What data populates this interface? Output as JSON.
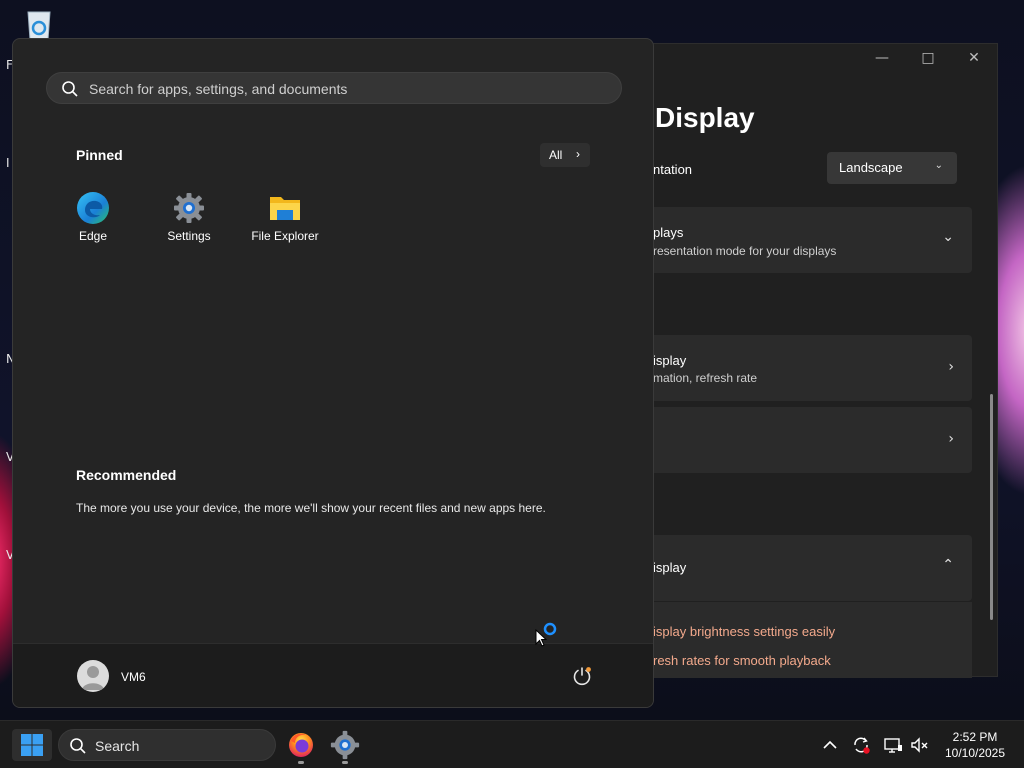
{
  "desktop": {
    "fragments": [
      "F",
      "I",
      "N",
      "V",
      "V"
    ]
  },
  "settings_window": {
    "title": "Display",
    "orientation_label": "ntation",
    "orientation_value": "Landscape",
    "multiple_displays_title": "plays",
    "multiple_displays_sub": "resentation mode for your displays",
    "advanced_display_title": "isplay",
    "advanced_display_sub": "mation, refresh rate",
    "hdr_title": "isplay",
    "hdr_link_1": "isplay brightness settings easily",
    "hdr_link_2": "resh rates for smooth playback"
  },
  "start_menu": {
    "search_placeholder": "Search for apps, settings, and documents",
    "pinned_heading": "Pinned",
    "all_button": "All",
    "pinned_apps": [
      {
        "label": "Edge",
        "icon": "edge-icon"
      },
      {
        "label": "Settings",
        "icon": "settings-gear-icon"
      },
      {
        "label": "File Explorer",
        "icon": "file-explorer-icon"
      }
    ],
    "recommended_heading": "Recommended",
    "recommended_text": "The more you use your device, the more we'll show your recent files and new apps here.",
    "user_name": "VM6"
  },
  "taskbar": {
    "search_label": "Search",
    "time": "2:52 PM",
    "date": "10/10/2025"
  },
  "colors": {
    "accent": "#0078d4",
    "start_bg": "#242424",
    "link_orange": "#f3a98c"
  }
}
